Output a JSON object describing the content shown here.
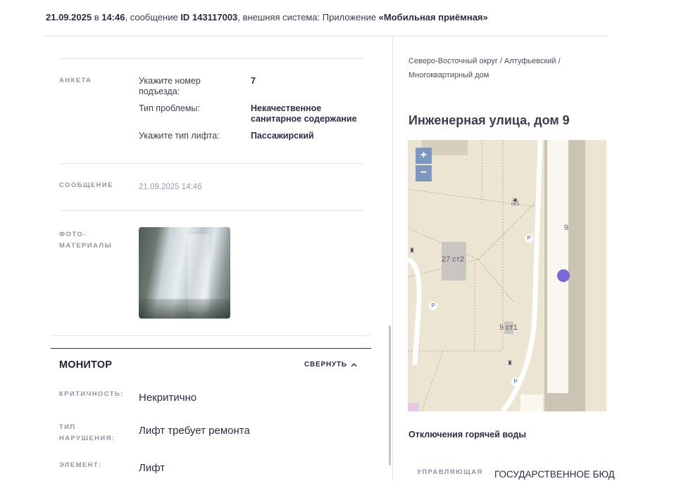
{
  "header": {
    "date": "21.09.2025",
    "sep_in": " в ",
    "time": "14:46",
    "msg_prefix": ", сообщение ",
    "message_id": "ID 143117003",
    "system_text": ", внешняя система: Приложение ",
    "app_name": "«Мобильная приёмная»"
  },
  "questionnaire": {
    "label": "АНКЕТА",
    "rows": [
      {
        "question": "Укажите номер подъезда:",
        "answer": "7"
      },
      {
        "question": "Тип проблемы:",
        "answer": "Некачественное санитарное содержание"
      },
      {
        "question": "Укажите тип лифта:",
        "answer": "Пассажирский"
      }
    ]
  },
  "message_section": {
    "label": "СООБЩЕНИЕ",
    "date": "21.09.2025 14:46"
  },
  "photo_section": {
    "label": "ФОТО-МАТЕРИАЛЫ"
  },
  "monitor": {
    "title": "МОНИТОР",
    "collapse_label": "СВЕРНУТЬ",
    "fields": [
      {
        "label": "КРИТИЧНОСТЬ:",
        "value": "Некритично"
      },
      {
        "label": "ТИП НАРУШЕНИЯ:",
        "value": "Лифт требует ремонта"
      },
      {
        "label": "ЭЛЕМЕНТ:",
        "value": "Лифт"
      }
    ]
  },
  "location": {
    "breadcrumb": "Северо-Восточный округ / Алтуфьевский / Многоквартирный дом",
    "address": "Инженерная улица, дом 9"
  },
  "map": {
    "zoom_in": "+",
    "zoom_out": "−",
    "labels": {
      "building_27": "27 ст2",
      "building_9": "9",
      "building_9_1": "9 ст1",
      "parking": "P"
    },
    "marker_color": "#7b68d9"
  },
  "hot_water": {
    "title": "Отключения горячей воды"
  },
  "management": {
    "label": "УПРАВЛЯЮЩАЯ",
    "value": "ГОСУДАРСТВЕННОЕ БЮД"
  }
}
